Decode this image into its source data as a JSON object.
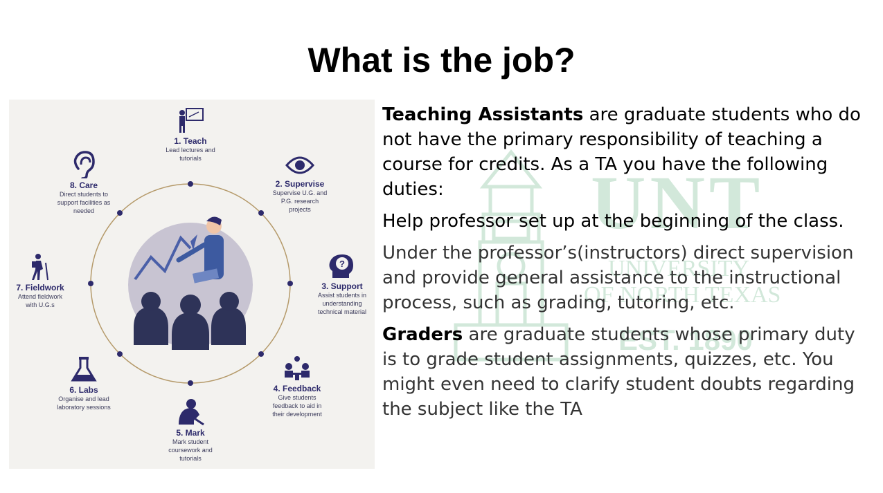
{
  "slide": {
    "title": "What is the job?"
  },
  "infographic": {
    "steps": [
      {
        "num_title": "1. Teach",
        "desc": "Lead lectures and tutorials",
        "icon": "teacher-board-icon"
      },
      {
        "num_title": "2. Supervise",
        "desc": "Supervise U.G. and P.G. research projects",
        "icon": "eye-icon"
      },
      {
        "num_title": "3. Support",
        "desc": "Assist students in understanding technical material",
        "icon": "head-question-icon"
      },
      {
        "num_title": "4. Feedback",
        "desc": "Give students feedback to aid in their development",
        "icon": "meeting-icon"
      },
      {
        "num_title": "5. Mark",
        "desc": "Mark student coursework and tutorials",
        "icon": "person-writing-icon"
      },
      {
        "num_title": "6. Labs",
        "desc": "Organise and lead laboratory sessions",
        "icon": "flask-icon"
      },
      {
        "num_title": "7. Fieldwork",
        "desc": "Attend fieldwork with U.G.s",
        "icon": "hiker-icon"
      },
      {
        "num_title": "8. Care",
        "desc": "Direct students to support facilities as needed",
        "icon": "ear-icon"
      }
    ],
    "colors": {
      "accent": "#2d2a6b",
      "ring": "#b59a6a",
      "background": "#f3f2ef"
    }
  },
  "watermark": {
    "logo": "UNT",
    "line1": "UNIVERSITY",
    "line2": "OF NORTH TEXAS",
    "est": "EST. 1890",
    "color": "#5fae7d"
  },
  "content": {
    "p1_bold": "Teaching Assistants",
    "p1_rest": " are graduate students who do not have the primary responsibility of teaching a course for credits. As a TA you have the following duties:",
    "p2": "Help professor set up at the beginning of the class.",
    "p3": "Under the professor’s(instructors) direct supervision and provide general assistance to the instructional process, such as grading, tutoring, etc.",
    "p4_bold": "Graders",
    "p4_rest": " are graduate students whose primary duty is to grade student assignments, quizzes, etc. You might even need to clarify student doubts regarding the subject like the TA"
  }
}
